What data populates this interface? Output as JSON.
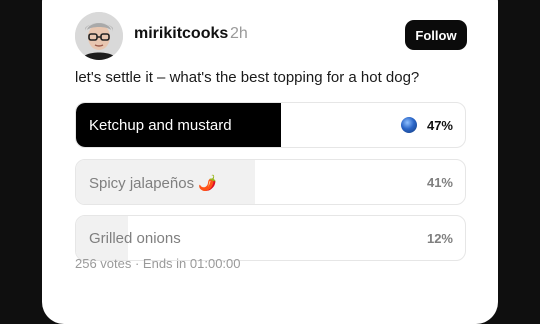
{
  "post": {
    "username": "mirikitcooks",
    "time": "2h",
    "follow_label": "Follow",
    "question": "let's settle it – what's the best topping for a hot dog?"
  },
  "poll": {
    "options": [
      {
        "label": "Ketchup and mustard",
        "percent": "47%",
        "fraction": 0.47,
        "selected": true
      },
      {
        "label": "Spicy jalapeños 🌶️",
        "percent": "41%",
        "fraction": 0.41,
        "selected": false
      },
      {
        "label": "Grilled onions",
        "percent": "12%",
        "fraction": 0.12,
        "selected": false
      }
    ],
    "meta": "256 votes · Ends in 01:00:00"
  },
  "colors": {
    "selected_fill": "#000000",
    "other_fill": "#f1f1f1",
    "selected_text": "#ffffff",
    "other_text": "#7f7f7f"
  },
  "icons": {
    "avatar": "user-avatar",
    "winner": "globe-icon"
  }
}
